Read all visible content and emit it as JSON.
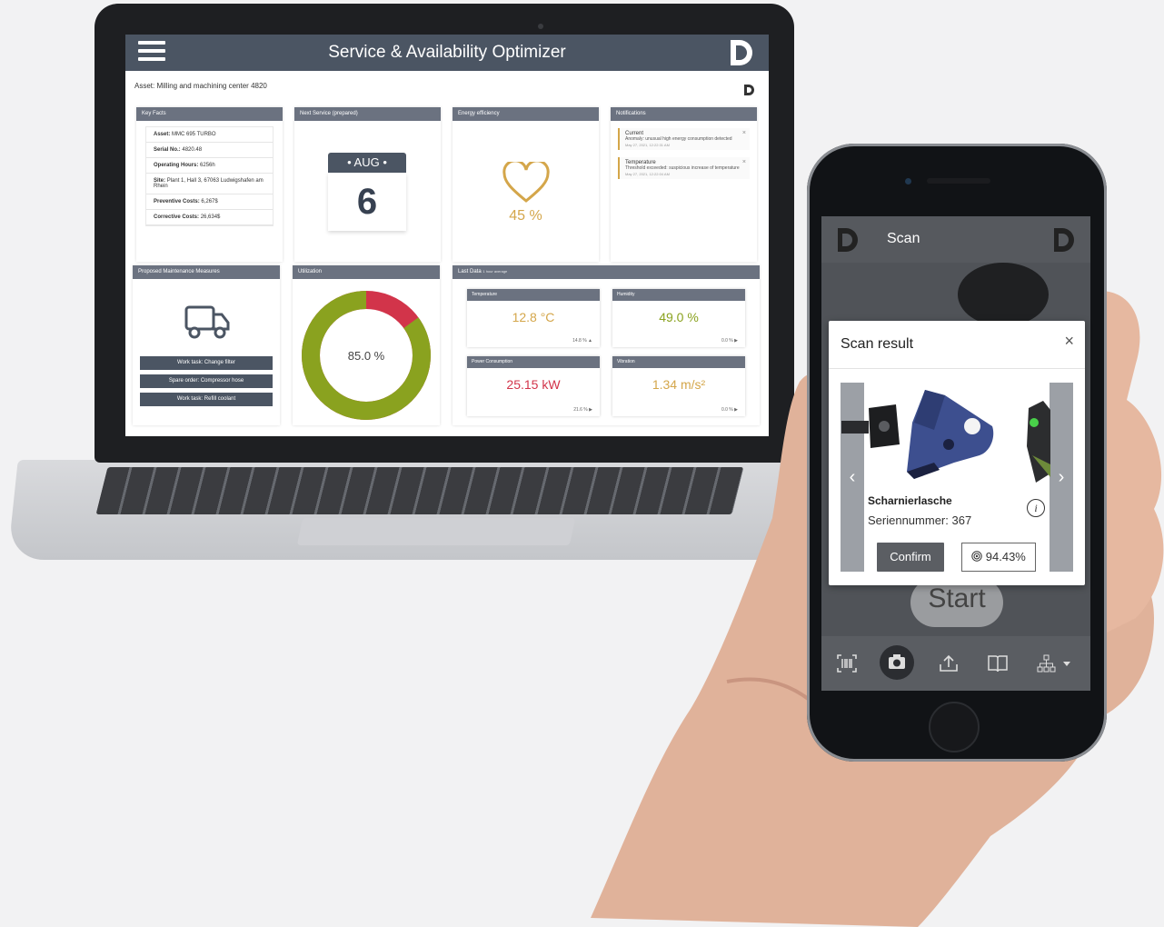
{
  "laptop": {
    "app_title": "Service & Availability Optimizer",
    "asset_line": "Asset: Milling and machining center 4820",
    "key_facts": {
      "title": "Key Facts",
      "rows": [
        {
          "label": "Asset:",
          "value": "MMC 695 TURBO"
        },
        {
          "label": "Serial No.:",
          "value": "4820.48"
        },
        {
          "label": "Operating Hours:",
          "value": "6256h"
        },
        {
          "label": "Site:",
          "value": "Plant 1, Hall 3, 67063 Ludwigshafen am Rhein"
        },
        {
          "label": "Preventive Costs:",
          "value": "6,267$"
        },
        {
          "label": "Corrective Costs:",
          "value": "26,634$"
        }
      ]
    },
    "next_service": {
      "title": "Next Service (prepared)",
      "month": "AUG",
      "day": "6"
    },
    "energy": {
      "title": "Energy efficiency",
      "value": "45 %",
      "pct": 45
    },
    "notifications": {
      "title": "Notifications",
      "items": [
        {
          "title": "Current",
          "text": "Anomaly: unusual high energy consumption detected",
          "date": "May 27, 2021, 12:22:31 AM"
        },
        {
          "title": "Temperature",
          "text": "Threshold exceeded: suspicious increase of temperature",
          "date": "May 27, 2021, 12:22:04 AM"
        }
      ]
    },
    "maintenance": {
      "title": "Proposed Maintenance Measures",
      "buttons": [
        "Work task: Change filter",
        "Spare order: Compressor hose",
        "Work task: Refill coolant"
      ]
    },
    "utilization": {
      "title": "Utilization",
      "value": "85.0 %",
      "pct": 85.0,
      "colors": {
        "used": "#8aa21f",
        "rest": "#d2344a"
      }
    },
    "last_data": {
      "title": "Last Data",
      "subtitle": "1 hour average",
      "tiles": [
        {
          "title": "Temperature",
          "value": "12.8 °C",
          "trend": "14.8 % ▲",
          "color": "#d4a64a"
        },
        {
          "title": "Humidity",
          "value": "49.0 %",
          "trend": "0.0 % ▶",
          "color": "#8aa21f"
        },
        {
          "title": "Power Consumption",
          "value": "25.15 kW",
          "trend": "21.6 % ▶",
          "color": "#d2344a"
        },
        {
          "title": "Vibration",
          "value": "1.34 m/s²",
          "trend": "0.0 % ▶",
          "color": "#d4a64a"
        }
      ]
    }
  },
  "phone": {
    "header_title": "Scan",
    "start_label": "Start",
    "modal": {
      "title": "Scan result",
      "close": "×",
      "part_name": "Scharnierlasche",
      "serial": "Seriennummer: 367",
      "confirm": "Confirm",
      "score": "94.43%",
      "prev": "‹",
      "next": "›",
      "info": "i"
    },
    "toolbar_icons": [
      "barcode-icon",
      "camera-icon",
      "upload-icon",
      "book-icon",
      "hierarchy-icon"
    ]
  }
}
